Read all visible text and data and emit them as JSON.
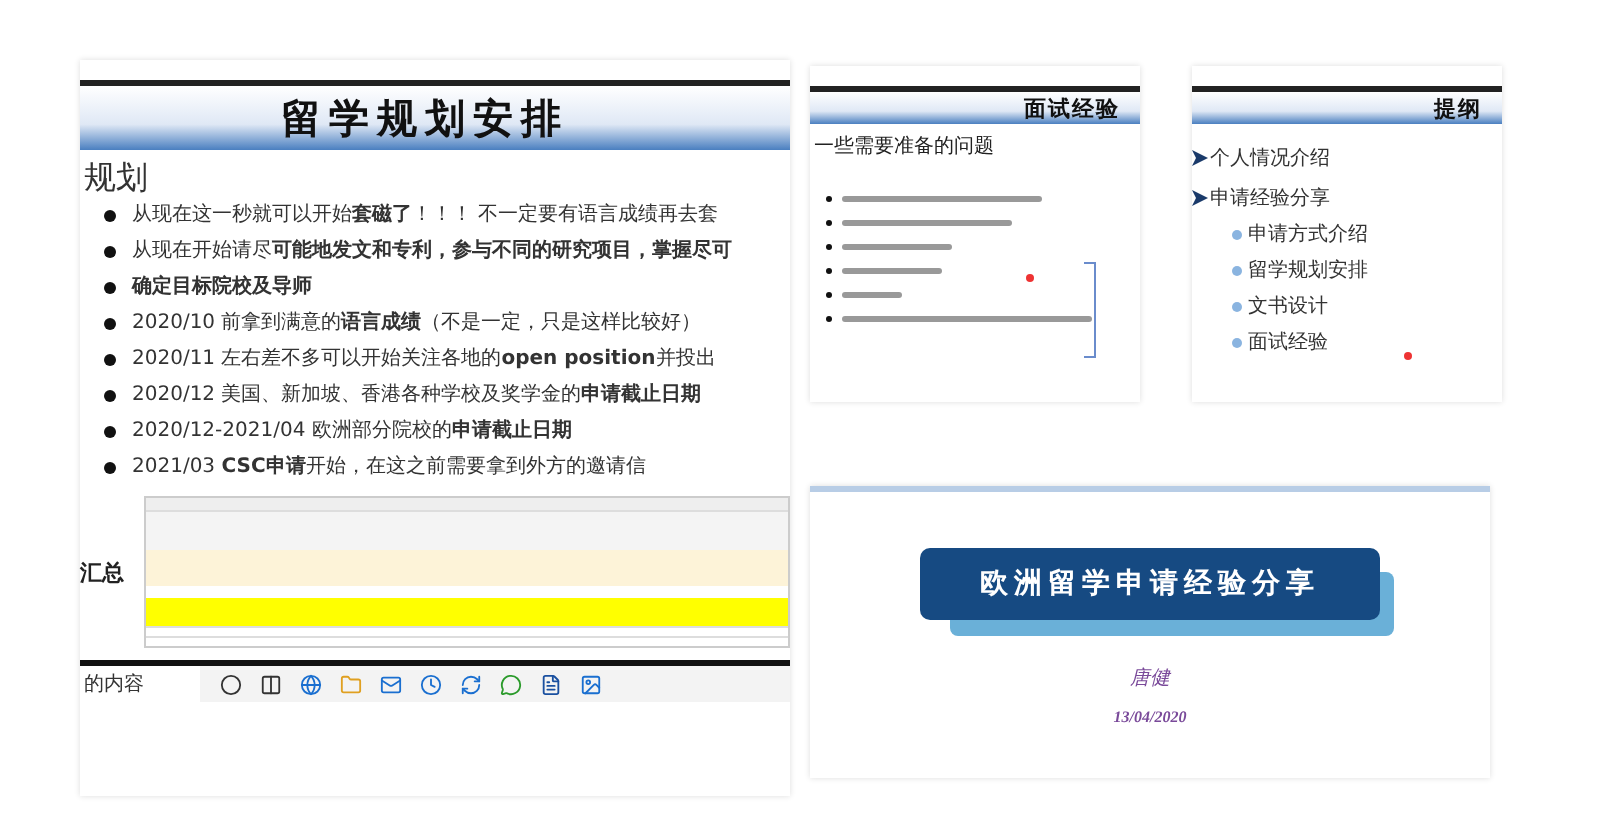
{
  "main_slide": {
    "title": "留学规划安排",
    "section": "规划",
    "bullets": [
      {
        "text": "从现在这一秒就可以开始**套磁了**！！！ 不一定要有语言成绩再去套"
      },
      {
        "text": "从现在开始请尽**可能地发文和专利，参与不同的研究项目，掌握尽可**"
      },
      {
        "text": "**确定目标院校及导师**"
      },
      {
        "text": "2020/10 前拿到满意的**语言成绩**（不是一定，只是这样比较好）"
      },
      {
        "text": "2020/11 左右差不多可以开始关注各地的**open position**并投出"
      },
      {
        "text": "2020/12 美国、新加坡、香港各种学校及奖学金的**申请截止日期**"
      },
      {
        "text": "2020/12-2021/04 欧洲部分院校的**申请截止日期**"
      },
      {
        "text": "2021/03 **CSC申请**开始，在这之前需要拿到外方的邀请信"
      }
    ],
    "summary_label": "汇总",
    "taskbar_search": "的内容"
  },
  "interview_slide": {
    "title": "面试经验",
    "subtitle": "一些需要准备的问题"
  },
  "outline_slide": {
    "title": "提纲",
    "items": [
      {
        "text": "个人情况介绍"
      },
      {
        "text": "申请经验分享",
        "children": [
          {
            "text": "申请方式介绍"
          },
          {
            "text": "留学规划安排"
          },
          {
            "text": "文书设计"
          },
          {
            "text": "面试经验"
          }
        ]
      }
    ]
  },
  "cover_slide": {
    "title": "欧洲留学申请经验分享",
    "author": "唐健",
    "date": "13/04/2020"
  }
}
